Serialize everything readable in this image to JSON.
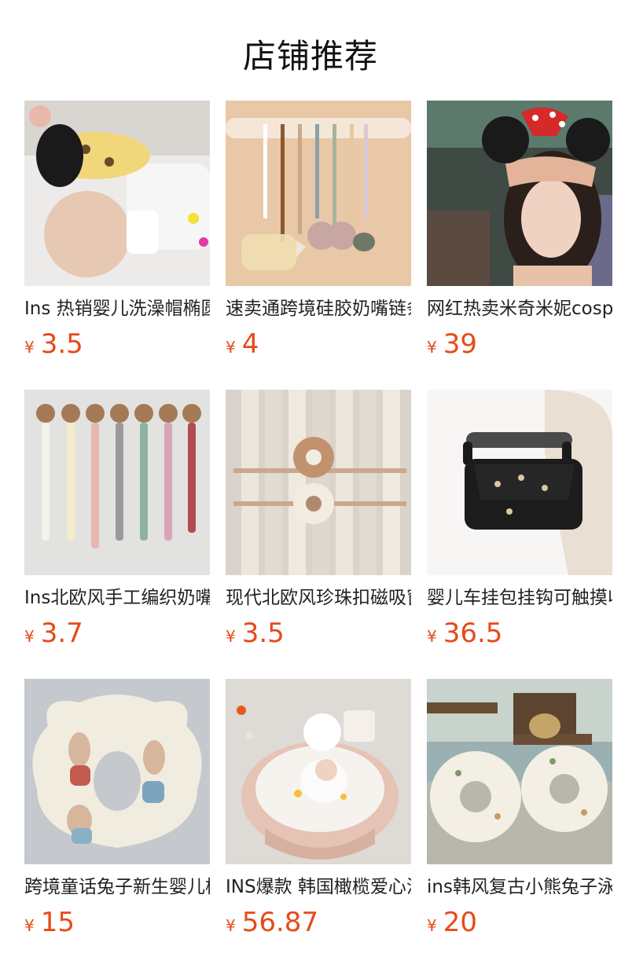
{
  "page": {
    "title": "店铺推荐"
  },
  "price_color": "#e64a19",
  "products": [
    {
      "name": "Ins 热销婴儿洗澡帽椭圆",
      "currency": "¥",
      "price": "3.5"
    },
    {
      "name": "速卖通跨境硅胶奶嘴链条",
      "currency": "¥",
      "price": "4"
    },
    {
      "name": "网红热卖米奇米妮cosplay",
      "currency": "¥",
      "price": "39"
    },
    {
      "name": "Ins北欧风手工编织奶嘴链",
      "currency": "¥",
      "price": "3.7"
    },
    {
      "name": "现代北欧风珍珠扣磁吸窗帘",
      "currency": "¥",
      "price": "3.5"
    },
    {
      "name": "婴儿车挂包挂钩可触摸收纳",
      "currency": "¥",
      "price": "36.5"
    },
    {
      "name": "跨境童话兔子新生婴儿枕头",
      "currency": "¥",
      "price": "15"
    },
    {
      "name": "INS爆款 韩国橄榄爱心浴盆",
      "currency": "¥",
      "price": "56.87"
    },
    {
      "name": "ins韩风复古小熊兔子泳圈",
      "currency": "¥",
      "price": "20"
    }
  ]
}
